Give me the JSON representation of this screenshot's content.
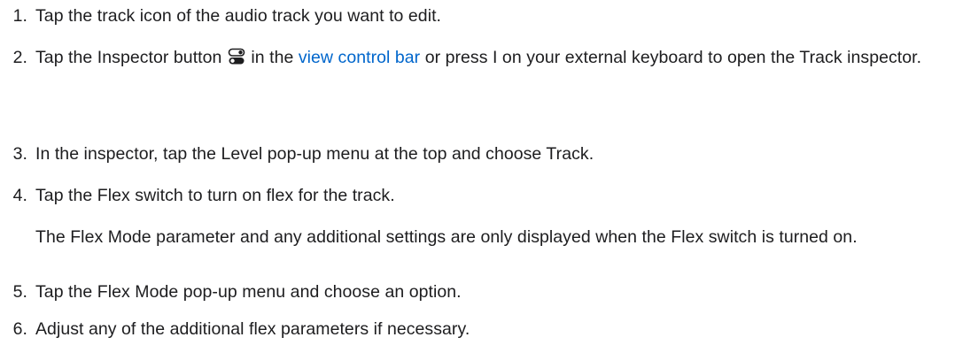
{
  "steps": [
    {
      "number": "1.",
      "text": "Tap the track icon of the audio track you want to edit."
    },
    {
      "number": "2.",
      "text_before": "Tap the Inspector button",
      "icon": "inspector-icon",
      "text_middle": "in the",
      "link": "view control bar",
      "text_after": "or press I on your external keyboard to open the Track inspector."
    },
    {
      "number": "3.",
      "text": "In the inspector, tap the Level pop-up menu at the top and choose Track."
    },
    {
      "number": "4.",
      "text": "Tap the Flex switch to turn on flex for the track.",
      "note": "The Flex Mode parameter and any additional settings are only displayed when the Flex switch is turned on."
    },
    {
      "number": "5.",
      "text": "Tap the Flex Mode pop-up menu and choose an option."
    },
    {
      "number": "6.",
      "text": "Adjust any of the additional flex parameters if necessary."
    }
  ],
  "colors": {
    "text": "#1d1d1f",
    "link": "#0066cc"
  }
}
